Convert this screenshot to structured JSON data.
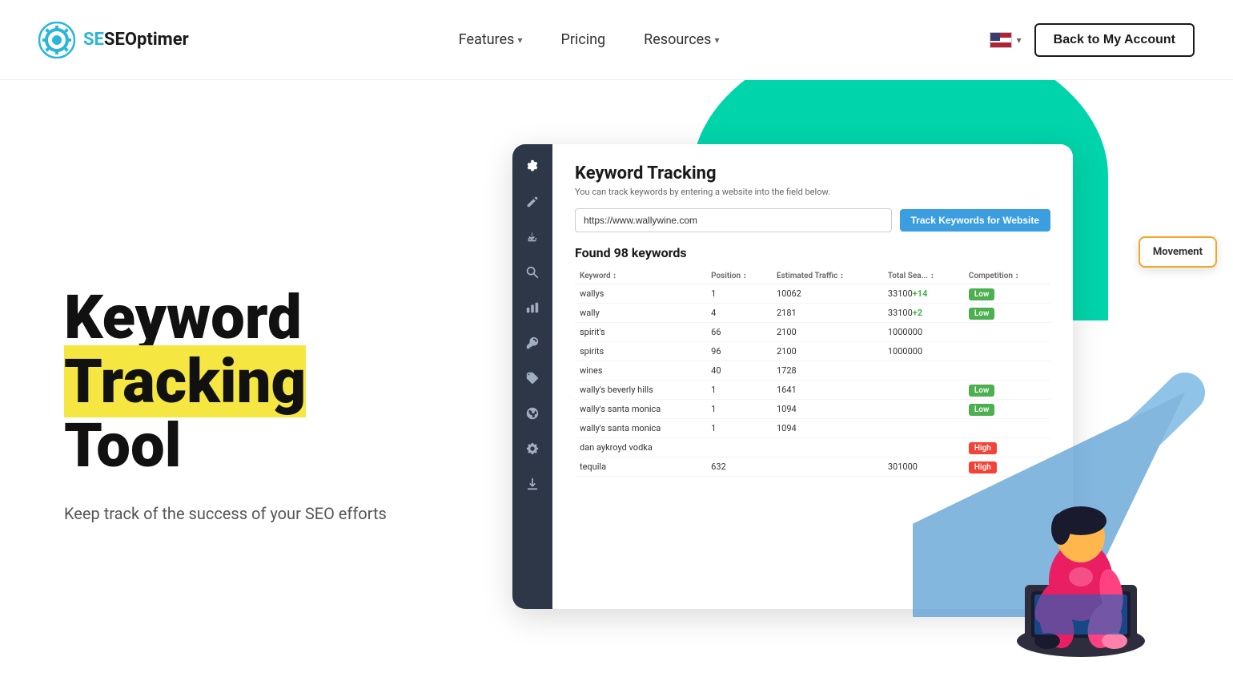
{
  "header": {
    "logo_text": "SEOptimer",
    "nav": {
      "features_label": "Features",
      "pricing_label": "Pricing",
      "resources_label": "Resources"
    },
    "back_button": "Back to My Account"
  },
  "hero": {
    "title_line1": "Keyword",
    "title_line2": "Tracking",
    "title_line3": "Tool",
    "subtitle": "Keep track of the success of your SEO efforts"
  },
  "dashboard": {
    "title": "Keyword Tracking",
    "subtitle": "You can track keywords by entering a website into the field below.",
    "search_value": "https://www.wallywine.com",
    "track_btn": "Track Keywords for Website",
    "found_label": "Found 98 keywords",
    "movement_popup": "Movement",
    "table": {
      "headers": [
        "Keyword",
        "Position",
        "Estimated Traffic",
        "Total Sea...",
        "Competition"
      ],
      "rows": [
        {
          "keyword": "wallys",
          "position": "1",
          "traffic": "10062",
          "total": "33100",
          "movement": "+14",
          "competition": "Low"
        },
        {
          "keyword": "wally",
          "position": "4",
          "traffic": "2181",
          "total": "33100",
          "movement": "+2",
          "competition": "Low"
        },
        {
          "keyword": "spirit's",
          "position": "66",
          "traffic": "2100",
          "total": "1000000",
          "movement": "",
          "competition": ""
        },
        {
          "keyword": "spirits",
          "position": "96",
          "traffic": "2100",
          "total": "1000000",
          "movement": "",
          "competition": ""
        },
        {
          "keyword": "wines",
          "position": "40",
          "traffic": "1728",
          "total": "",
          "movement": "",
          "competition": ""
        },
        {
          "keyword": "wally's beverly hills",
          "position": "1",
          "traffic": "1641",
          "total": "",
          "movement": "",
          "competition": "Low"
        },
        {
          "keyword": "wally's santa monica",
          "position": "1",
          "traffic": "1094",
          "total": "",
          "movement": "",
          "competition": "Low"
        },
        {
          "keyword": "wally's santa monica",
          "position": "1",
          "traffic": "1094",
          "total": "",
          "movement": "",
          "competition": ""
        },
        {
          "keyword": "dan aykroyd vodka",
          "position": "",
          "traffic": "",
          "total": "",
          "movement": "",
          "competition": "High"
        },
        {
          "keyword": "tequila",
          "position": "632",
          "traffic": "",
          "total": "301000",
          "movement": "",
          "competition": "High"
        }
      ]
    }
  }
}
